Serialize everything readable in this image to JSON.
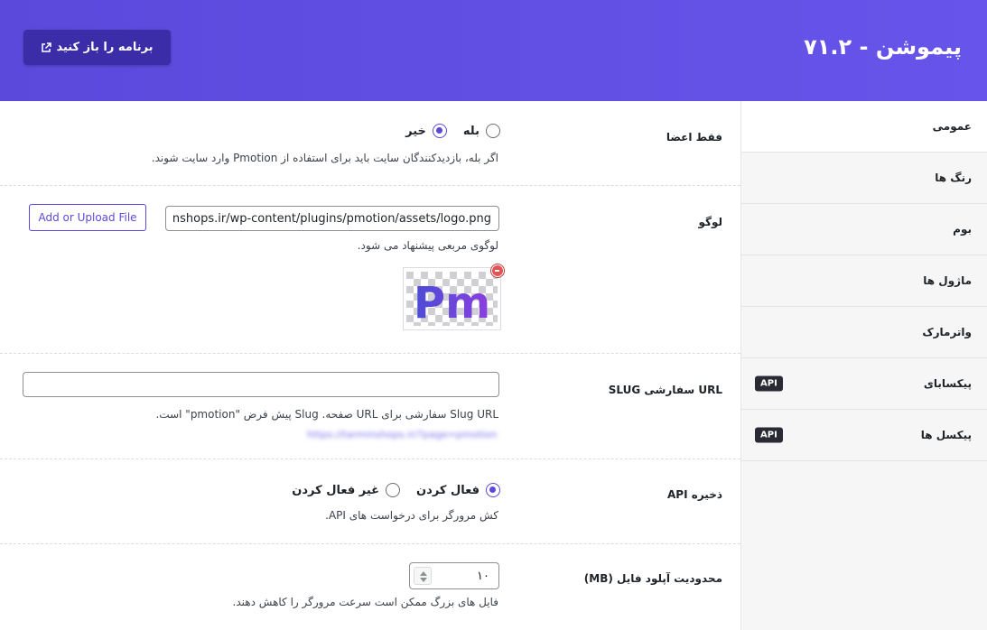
{
  "header": {
    "title": "پیموشن - ۷۱.۲",
    "open_app_label": "برنامه را باز کنید",
    "colors": {
      "start": "#5b49dc",
      "end": "#6754ea",
      "button": "#3b2ca8"
    }
  },
  "sidebar": {
    "items": [
      {
        "label": "عمومی"
      },
      {
        "label": "رنگ ها"
      },
      {
        "label": "بوم"
      },
      {
        "label": "ماژول ها"
      },
      {
        "label": "واترمارک"
      },
      {
        "label": "پیکسابای",
        "badge": "API"
      },
      {
        "label": "پیکسل ها",
        "badge": "API"
      }
    ]
  },
  "settings": {
    "members_only": {
      "label": "فقط اعضا",
      "options": {
        "yes": "بله",
        "no": "خیر"
      },
      "selected": "no",
      "description": "اگر بله، بازدیدکنندگان سایت باید برای استفاده از Pmotion وارد سایت شوند."
    },
    "logo": {
      "label": "لوگو",
      "value": "https://nshops.ir/wp-content/plugins/pmotion/assets/logo.png",
      "button_label": "Add or Upload File",
      "description": "لوگوی مربعی پیشنهاد می شود.",
      "logo_text": "Pm",
      "remove_icon": "remove-icon"
    },
    "slug": {
      "label": "URL سفارشی SLUG",
      "value": "",
      "description": "Slug URL سفارشی برای URL صفحه. Slug پیش فرض \"pmotion\" است.",
      "blurred_link": "https://tarminshops.ir/?page=pmotion"
    },
    "api_cache": {
      "label": "ذخیره API",
      "options": {
        "enable": "فعال کردن",
        "disable": "غیر فعال کردن"
      },
      "selected": "enable",
      "description": "کش مرورگر برای درخواست های API."
    },
    "upload_limit": {
      "label": "محدودیت آپلود فایل (MB)",
      "value": "۱۰",
      "description": "فایل های بزرگ ممکن است سرعت مرورگر را کاهش دهند."
    }
  }
}
